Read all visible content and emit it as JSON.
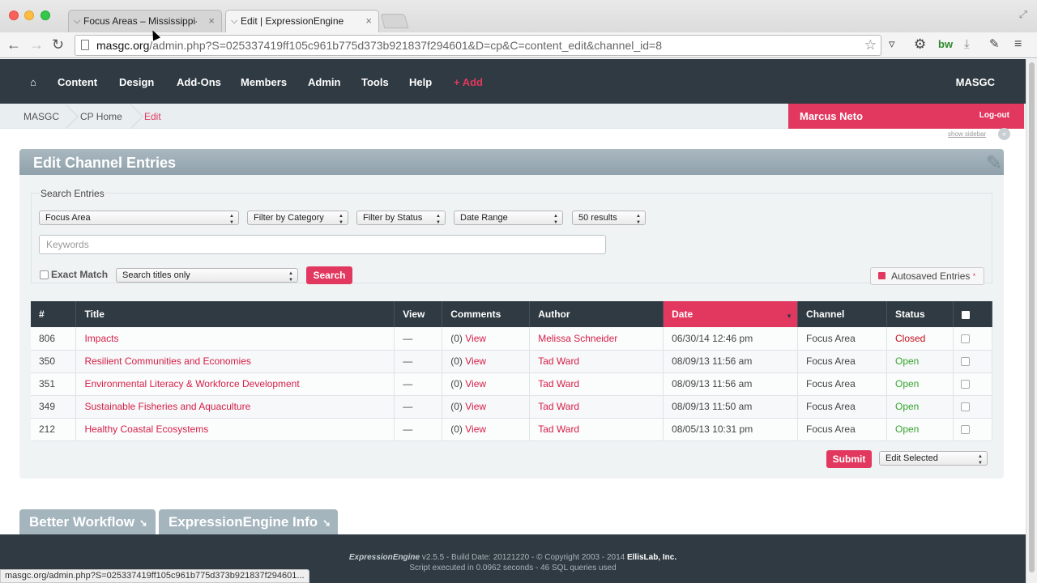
{
  "browser": {
    "tabs": [
      {
        "label": "Focus Areas – Mississippi-",
        "active": false
      },
      {
        "label": "Edit | ExpressionEngine",
        "active": true
      }
    ],
    "url_host": "masgc.org",
    "url_path": "/admin.php?S=025337419ff105c961b775d373b921837f294601&D=cp&C=content_edit&channel_id=8",
    "extension_bw": "bw",
    "status_url": "masgc.org/admin.php?S=025337419ff105c961b775d373b921837f294601..."
  },
  "topnav": {
    "items": [
      "Content",
      "Design",
      "Add-Ons",
      "Members",
      "Admin",
      "Tools",
      "Help"
    ],
    "add": "+ Add",
    "site": "MASGC"
  },
  "breadcrumb": [
    "MASGC",
    "CP Home",
    "Edit"
  ],
  "user": {
    "name": "Marcus Neto",
    "logout": "Log-out",
    "show_sidebar": "show sidebar"
  },
  "panel": {
    "title": "Edit Channel Entries",
    "search_legend": "Search Entries",
    "filters": {
      "channel": "Focus Area",
      "category": "Filter by Category",
      "status": "Filter by Status",
      "date": "Date Range",
      "results": "50 results"
    },
    "keywords_placeholder": "Keywords",
    "exact_match": "Exact Match",
    "search_scope": "Search titles only",
    "search_button": "Search",
    "autosaved": "Autosaved Entries",
    "autosaved_mark": "*"
  },
  "table": {
    "headers": [
      "#",
      "Title",
      "View",
      "Comments",
      "Author",
      "Date",
      "Channel",
      "Status"
    ],
    "rows": [
      {
        "id": "806",
        "title": "Impacts",
        "view": "—",
        "comments_count": "(0)",
        "comments_link": "View",
        "author": "Melissa Schneider",
        "date": "06/30/14 12:46 pm",
        "channel": "Focus Area",
        "status": "Closed"
      },
      {
        "id": "350",
        "title": "Resilient Communities and Economies",
        "view": "—",
        "comments_count": "(0)",
        "comments_link": "View",
        "author": "Tad Ward",
        "date": "08/09/13 11:56 am",
        "channel": "Focus Area",
        "status": "Open"
      },
      {
        "id": "351",
        "title": "Environmental Literacy & Workforce Development",
        "view": "—",
        "comments_count": "(0)",
        "comments_link": "View",
        "author": "Tad Ward",
        "date": "08/09/13 11:56 am",
        "channel": "Focus Area",
        "status": "Open"
      },
      {
        "id": "349",
        "title": "Sustainable Fisheries and Aquaculture",
        "view": "—",
        "comments_count": "(0)",
        "comments_link": "View",
        "author": "Tad Ward",
        "date": "08/09/13 11:50 am",
        "channel": "Focus Area",
        "status": "Open"
      },
      {
        "id": "212",
        "title": "Healthy Coastal Ecosystems",
        "view": "—",
        "comments_count": "(0)",
        "comments_link": "View",
        "author": "Tad Ward",
        "date": "08/05/13 10:31 pm",
        "channel": "Focus Area",
        "status": "Open"
      }
    ],
    "submit": "Submit",
    "bulk_action": "Edit Selected"
  },
  "footer_tabs": [
    "Better Workflow",
    "ExpressionEngine Info"
  ],
  "footer": {
    "logo": "ExpressionEngine",
    "version": "v2.5.5 - Build Date: 20121220 - © Copyright 2003 - 2014",
    "company": "EllisLab, Inc.",
    "stats": "Script executed in 0.0962 seconds - 46 SQL queries used"
  },
  "colors": {
    "accent": "#e2385f",
    "nav_bg": "#2f3a42",
    "open": "#37a42f",
    "closed": "#c00d19"
  }
}
